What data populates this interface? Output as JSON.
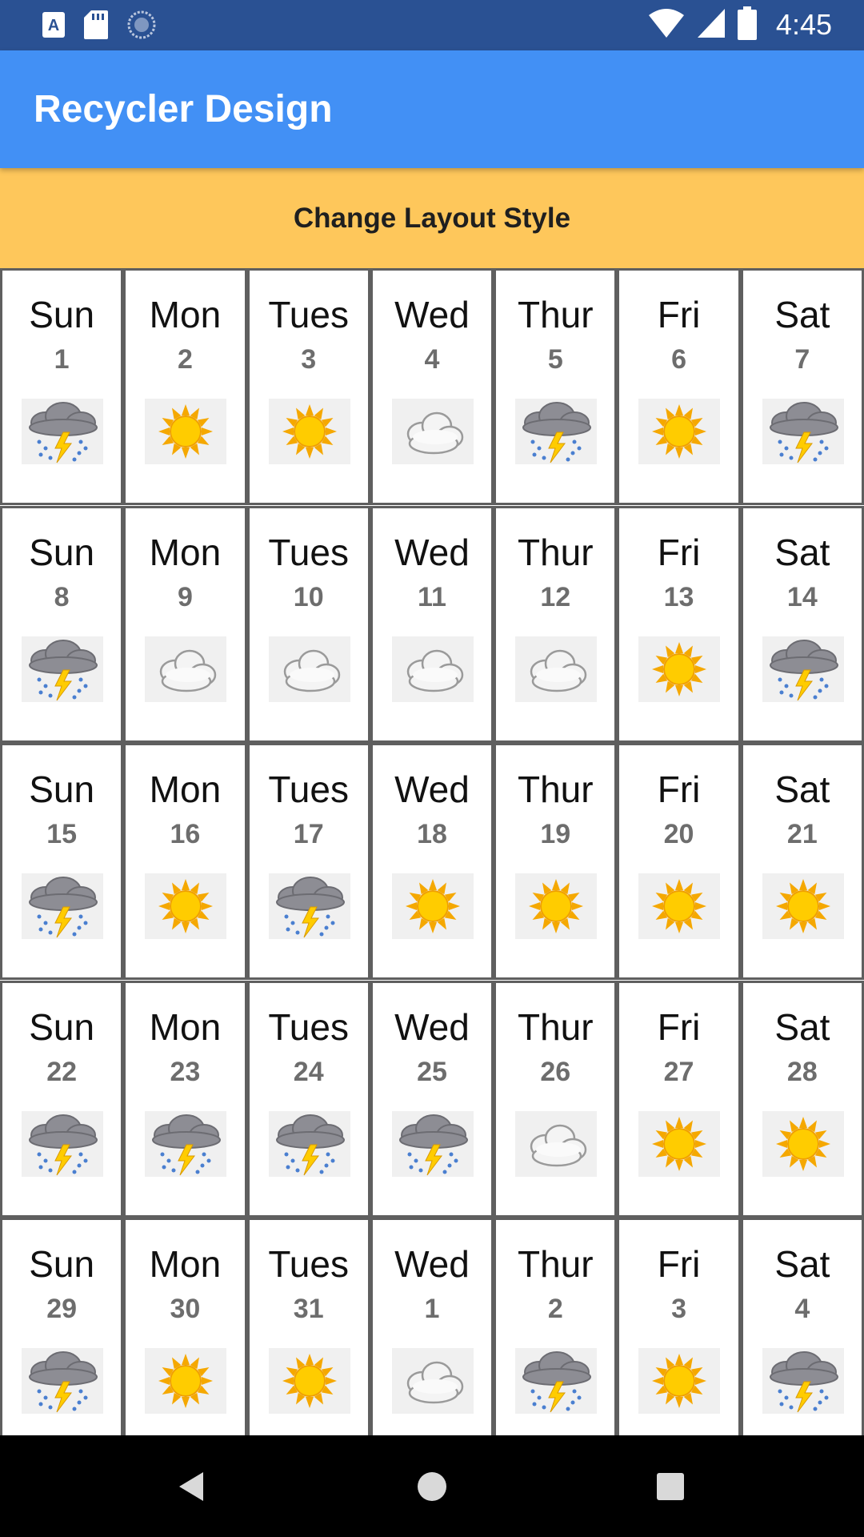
{
  "status_bar": {
    "time": "4:45",
    "left_icons": [
      "a-badge-icon",
      "sd-card-icon",
      "sync-icon"
    ],
    "right_icons": [
      "wifi-icon",
      "signal-icon",
      "battery-icon"
    ]
  },
  "app_bar": {
    "title": "Recycler Design"
  },
  "layout_button": {
    "label": "Change Layout Style"
  },
  "colors": {
    "status_bar": "#2a5193",
    "app_bar": "#4290f5",
    "button": "#fec75b",
    "nav_bar": "#000000"
  },
  "days": [
    {
      "name": "Sun",
      "number": "1",
      "weather": "storm"
    },
    {
      "name": "Mon",
      "number": "2",
      "weather": "sunny"
    },
    {
      "name": "Tues",
      "number": "3",
      "weather": "sunny"
    },
    {
      "name": "Wed",
      "number": "4",
      "weather": "cloudy"
    },
    {
      "name": "Thur",
      "number": "5",
      "weather": "storm"
    },
    {
      "name": "Fri",
      "number": "6",
      "weather": "sunny"
    },
    {
      "name": "Sat",
      "number": "7",
      "weather": "storm"
    },
    {
      "name": "Sun",
      "number": "8",
      "weather": "storm"
    },
    {
      "name": "Mon",
      "number": "9",
      "weather": "cloudy"
    },
    {
      "name": "Tues",
      "number": "10",
      "weather": "cloudy"
    },
    {
      "name": "Wed",
      "number": "11",
      "weather": "cloudy"
    },
    {
      "name": "Thur",
      "number": "12",
      "weather": "cloudy"
    },
    {
      "name": "Fri",
      "number": "13",
      "weather": "sunny"
    },
    {
      "name": "Sat",
      "number": "14",
      "weather": "storm"
    },
    {
      "name": "Sun",
      "number": "15",
      "weather": "storm"
    },
    {
      "name": "Mon",
      "number": "16",
      "weather": "sunny"
    },
    {
      "name": "Tues",
      "number": "17",
      "weather": "storm"
    },
    {
      "name": "Wed",
      "number": "18",
      "weather": "sunny"
    },
    {
      "name": "Thur",
      "number": "19",
      "weather": "sunny"
    },
    {
      "name": "Fri",
      "number": "20",
      "weather": "sunny"
    },
    {
      "name": "Sat",
      "number": "21",
      "weather": "sunny"
    },
    {
      "name": "Sun",
      "number": "22",
      "weather": "storm"
    },
    {
      "name": "Mon",
      "number": "23",
      "weather": "storm"
    },
    {
      "name": "Tues",
      "number": "24",
      "weather": "storm"
    },
    {
      "name": "Wed",
      "number": "25",
      "weather": "storm"
    },
    {
      "name": "Thur",
      "number": "26",
      "weather": "cloudy"
    },
    {
      "name": "Fri",
      "number": "27",
      "weather": "sunny"
    },
    {
      "name": "Sat",
      "number": "28",
      "weather": "sunny"
    },
    {
      "name": "Sun",
      "number": "29",
      "weather": "storm"
    },
    {
      "name": "Mon",
      "number": "30",
      "weather": "sunny"
    },
    {
      "name": "Tues",
      "number": "31",
      "weather": "sunny"
    },
    {
      "name": "Wed",
      "number": "1",
      "weather": "cloudy"
    },
    {
      "name": "Thur",
      "number": "2",
      "weather": "storm"
    },
    {
      "name": "Fri",
      "number": "3",
      "weather": "sunny"
    },
    {
      "name": "Sat",
      "number": "4",
      "weather": "storm"
    }
  ],
  "nav_bar": {
    "buttons": [
      "back-icon",
      "home-icon",
      "recents-icon"
    ]
  }
}
